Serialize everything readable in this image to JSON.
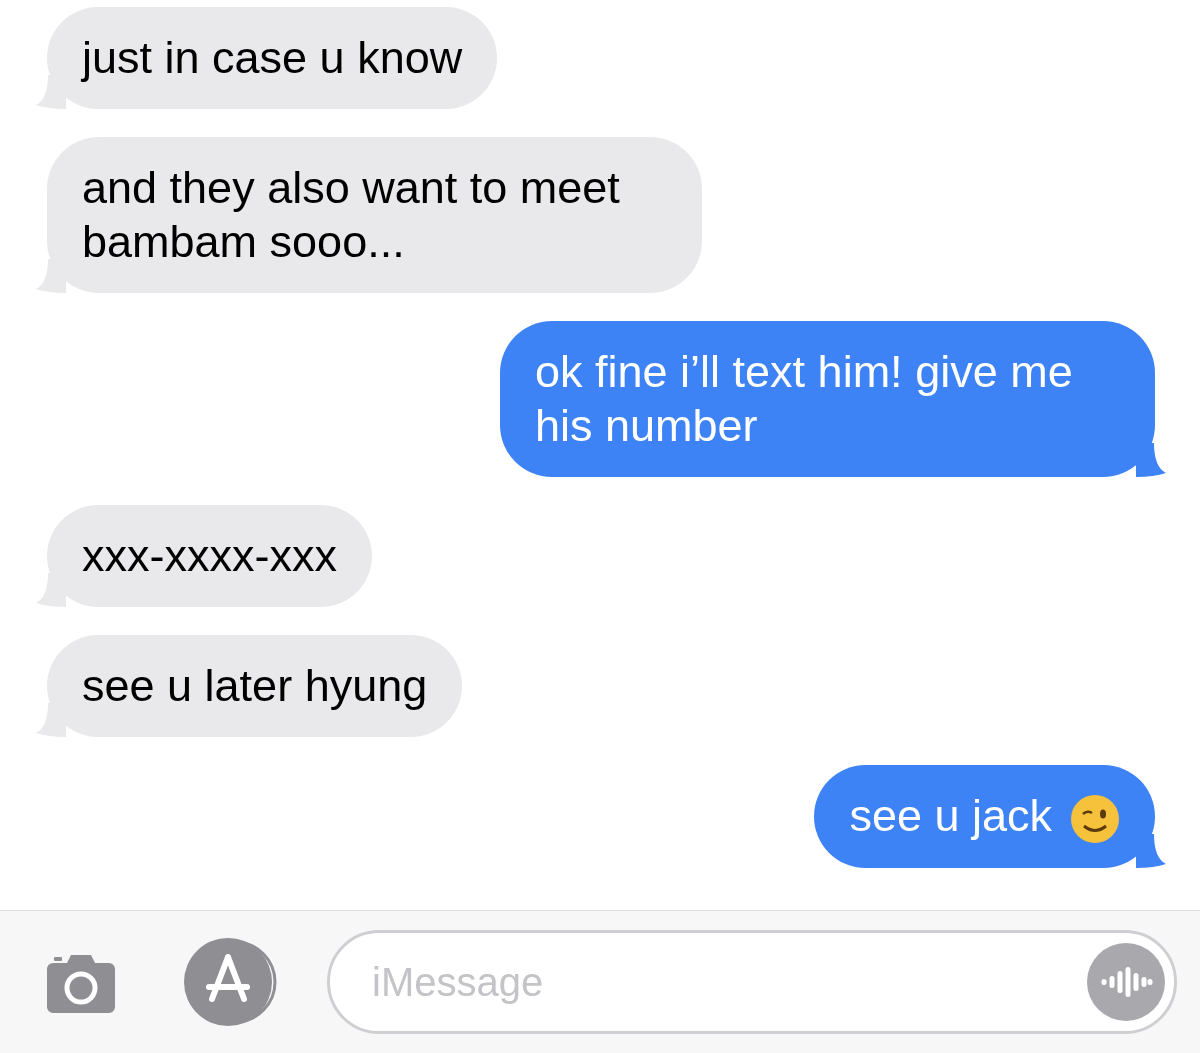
{
  "messages": [
    {
      "kind": "received",
      "text": "just in case u know",
      "emoji": false
    },
    {
      "kind": "received",
      "text": "and they also want to meet bambam sooo...",
      "emoji": false
    },
    {
      "kind": "sent",
      "text": "ok fine i’ll text him! give me his number",
      "emoji": false
    },
    {
      "kind": "received",
      "text": "xxx-xxxx-xxx",
      "emoji": false
    },
    {
      "kind": "received",
      "text": "see u later hyung",
      "emoji": false
    },
    {
      "kind": "sent",
      "text": "see u jack",
      "emoji": true
    }
  ],
  "composer": {
    "placeholder": "iMessage"
  }
}
